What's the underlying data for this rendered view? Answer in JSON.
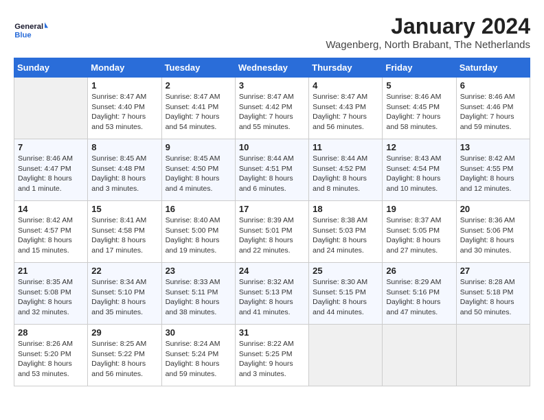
{
  "header": {
    "logo_line1": "General",
    "logo_line2": "Blue",
    "month_title": "January 2024",
    "location": "Wagenberg, North Brabant, The Netherlands"
  },
  "days_of_week": [
    "Sunday",
    "Monday",
    "Tuesday",
    "Wednesday",
    "Thursday",
    "Friday",
    "Saturday"
  ],
  "weeks": [
    [
      {
        "day": "",
        "sunrise": "",
        "sunset": "",
        "daylight": ""
      },
      {
        "day": "1",
        "sunrise": "Sunrise: 8:47 AM",
        "sunset": "Sunset: 4:40 PM",
        "daylight": "Daylight: 7 hours and 53 minutes."
      },
      {
        "day": "2",
        "sunrise": "Sunrise: 8:47 AM",
        "sunset": "Sunset: 4:41 PM",
        "daylight": "Daylight: 7 hours and 54 minutes."
      },
      {
        "day": "3",
        "sunrise": "Sunrise: 8:47 AM",
        "sunset": "Sunset: 4:42 PM",
        "daylight": "Daylight: 7 hours and 55 minutes."
      },
      {
        "day": "4",
        "sunrise": "Sunrise: 8:47 AM",
        "sunset": "Sunset: 4:43 PM",
        "daylight": "Daylight: 7 hours and 56 minutes."
      },
      {
        "day": "5",
        "sunrise": "Sunrise: 8:46 AM",
        "sunset": "Sunset: 4:45 PM",
        "daylight": "Daylight: 7 hours and 58 minutes."
      },
      {
        "day": "6",
        "sunrise": "Sunrise: 8:46 AM",
        "sunset": "Sunset: 4:46 PM",
        "daylight": "Daylight: 7 hours and 59 minutes."
      }
    ],
    [
      {
        "day": "7",
        "sunrise": "Sunrise: 8:46 AM",
        "sunset": "Sunset: 4:47 PM",
        "daylight": "Daylight: 8 hours and 1 minute."
      },
      {
        "day": "8",
        "sunrise": "Sunrise: 8:45 AM",
        "sunset": "Sunset: 4:48 PM",
        "daylight": "Daylight: 8 hours and 3 minutes."
      },
      {
        "day": "9",
        "sunrise": "Sunrise: 8:45 AM",
        "sunset": "Sunset: 4:50 PM",
        "daylight": "Daylight: 8 hours and 4 minutes."
      },
      {
        "day": "10",
        "sunrise": "Sunrise: 8:44 AM",
        "sunset": "Sunset: 4:51 PM",
        "daylight": "Daylight: 8 hours and 6 minutes."
      },
      {
        "day": "11",
        "sunrise": "Sunrise: 8:44 AM",
        "sunset": "Sunset: 4:52 PM",
        "daylight": "Daylight: 8 hours and 8 minutes."
      },
      {
        "day": "12",
        "sunrise": "Sunrise: 8:43 AM",
        "sunset": "Sunset: 4:54 PM",
        "daylight": "Daylight: 8 hours and 10 minutes."
      },
      {
        "day": "13",
        "sunrise": "Sunrise: 8:42 AM",
        "sunset": "Sunset: 4:55 PM",
        "daylight": "Daylight: 8 hours and 12 minutes."
      }
    ],
    [
      {
        "day": "14",
        "sunrise": "Sunrise: 8:42 AM",
        "sunset": "Sunset: 4:57 PM",
        "daylight": "Daylight: 8 hours and 15 minutes."
      },
      {
        "day": "15",
        "sunrise": "Sunrise: 8:41 AM",
        "sunset": "Sunset: 4:58 PM",
        "daylight": "Daylight: 8 hours and 17 minutes."
      },
      {
        "day": "16",
        "sunrise": "Sunrise: 8:40 AM",
        "sunset": "Sunset: 5:00 PM",
        "daylight": "Daylight: 8 hours and 19 minutes."
      },
      {
        "day": "17",
        "sunrise": "Sunrise: 8:39 AM",
        "sunset": "Sunset: 5:01 PM",
        "daylight": "Daylight: 8 hours and 22 minutes."
      },
      {
        "day": "18",
        "sunrise": "Sunrise: 8:38 AM",
        "sunset": "Sunset: 5:03 PM",
        "daylight": "Daylight: 8 hours and 24 minutes."
      },
      {
        "day": "19",
        "sunrise": "Sunrise: 8:37 AM",
        "sunset": "Sunset: 5:05 PM",
        "daylight": "Daylight: 8 hours and 27 minutes."
      },
      {
        "day": "20",
        "sunrise": "Sunrise: 8:36 AM",
        "sunset": "Sunset: 5:06 PM",
        "daylight": "Daylight: 8 hours and 30 minutes."
      }
    ],
    [
      {
        "day": "21",
        "sunrise": "Sunrise: 8:35 AM",
        "sunset": "Sunset: 5:08 PM",
        "daylight": "Daylight: 8 hours and 32 minutes."
      },
      {
        "day": "22",
        "sunrise": "Sunrise: 8:34 AM",
        "sunset": "Sunset: 5:10 PM",
        "daylight": "Daylight: 8 hours and 35 minutes."
      },
      {
        "day": "23",
        "sunrise": "Sunrise: 8:33 AM",
        "sunset": "Sunset: 5:11 PM",
        "daylight": "Daylight: 8 hours and 38 minutes."
      },
      {
        "day": "24",
        "sunrise": "Sunrise: 8:32 AM",
        "sunset": "Sunset: 5:13 PM",
        "daylight": "Daylight: 8 hours and 41 minutes."
      },
      {
        "day": "25",
        "sunrise": "Sunrise: 8:30 AM",
        "sunset": "Sunset: 5:15 PM",
        "daylight": "Daylight: 8 hours and 44 minutes."
      },
      {
        "day": "26",
        "sunrise": "Sunrise: 8:29 AM",
        "sunset": "Sunset: 5:16 PM",
        "daylight": "Daylight: 8 hours and 47 minutes."
      },
      {
        "day": "27",
        "sunrise": "Sunrise: 8:28 AM",
        "sunset": "Sunset: 5:18 PM",
        "daylight": "Daylight: 8 hours and 50 minutes."
      }
    ],
    [
      {
        "day": "28",
        "sunrise": "Sunrise: 8:26 AM",
        "sunset": "Sunset: 5:20 PM",
        "daylight": "Daylight: 8 hours and 53 minutes."
      },
      {
        "day": "29",
        "sunrise": "Sunrise: 8:25 AM",
        "sunset": "Sunset: 5:22 PM",
        "daylight": "Daylight: 8 hours and 56 minutes."
      },
      {
        "day": "30",
        "sunrise": "Sunrise: 8:24 AM",
        "sunset": "Sunset: 5:24 PM",
        "daylight": "Daylight: 8 hours and 59 minutes."
      },
      {
        "day": "31",
        "sunrise": "Sunrise: 8:22 AM",
        "sunset": "Sunset: 5:25 PM",
        "daylight": "Daylight: 9 hours and 3 minutes."
      },
      {
        "day": "",
        "sunrise": "",
        "sunset": "",
        "daylight": ""
      },
      {
        "day": "",
        "sunrise": "",
        "sunset": "",
        "daylight": ""
      },
      {
        "day": "",
        "sunrise": "",
        "sunset": "",
        "daylight": ""
      }
    ]
  ]
}
